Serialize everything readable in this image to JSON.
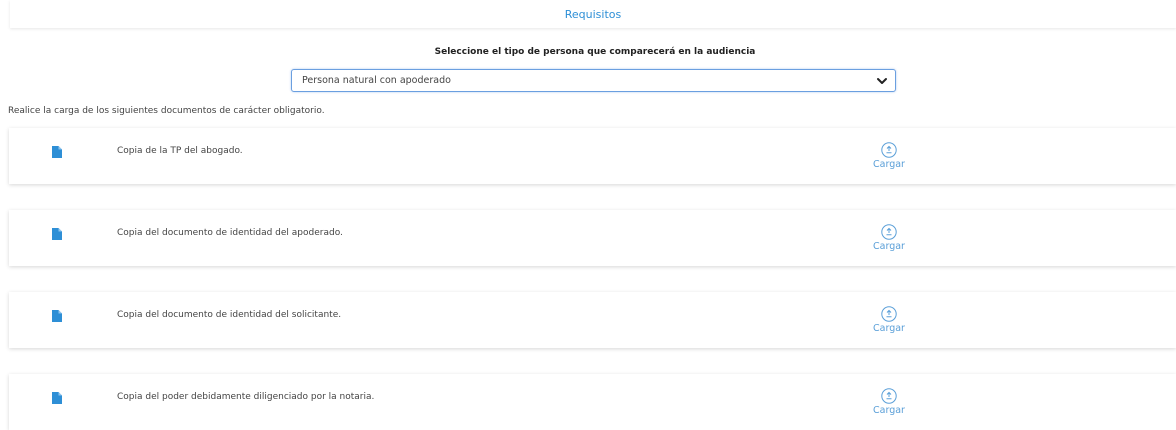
{
  "tabs": {
    "requisitos_label": "Requisitos"
  },
  "persona_section": {
    "prompt": "Seleccione el tipo de persona que comparecerá en la audiencia",
    "selected_value": "Persona natural con apoderado"
  },
  "instructions": "Realice la carga de los siguientes documentos de carácter obligatorio.",
  "documents": [
    {
      "label": "Copia de la TP del abogado.",
      "action": "Cargar"
    },
    {
      "label": "Copia del documento de identidad del apoderado.",
      "action": "Cargar"
    },
    {
      "label": "Copia del documento de identidad del solicitante.",
      "action": "Cargar"
    },
    {
      "label": "Copia del poder debidamente diligenciado por la notaria.",
      "action": "Cargar"
    }
  ],
  "icons": {
    "document": "document-icon",
    "upload": "upload-icon",
    "dropdown": "chevron-down-icon"
  },
  "colors": {
    "accent": "#2e8fd6",
    "doc_icon": "#2e8fd6",
    "upload": "#5a9fd8"
  }
}
